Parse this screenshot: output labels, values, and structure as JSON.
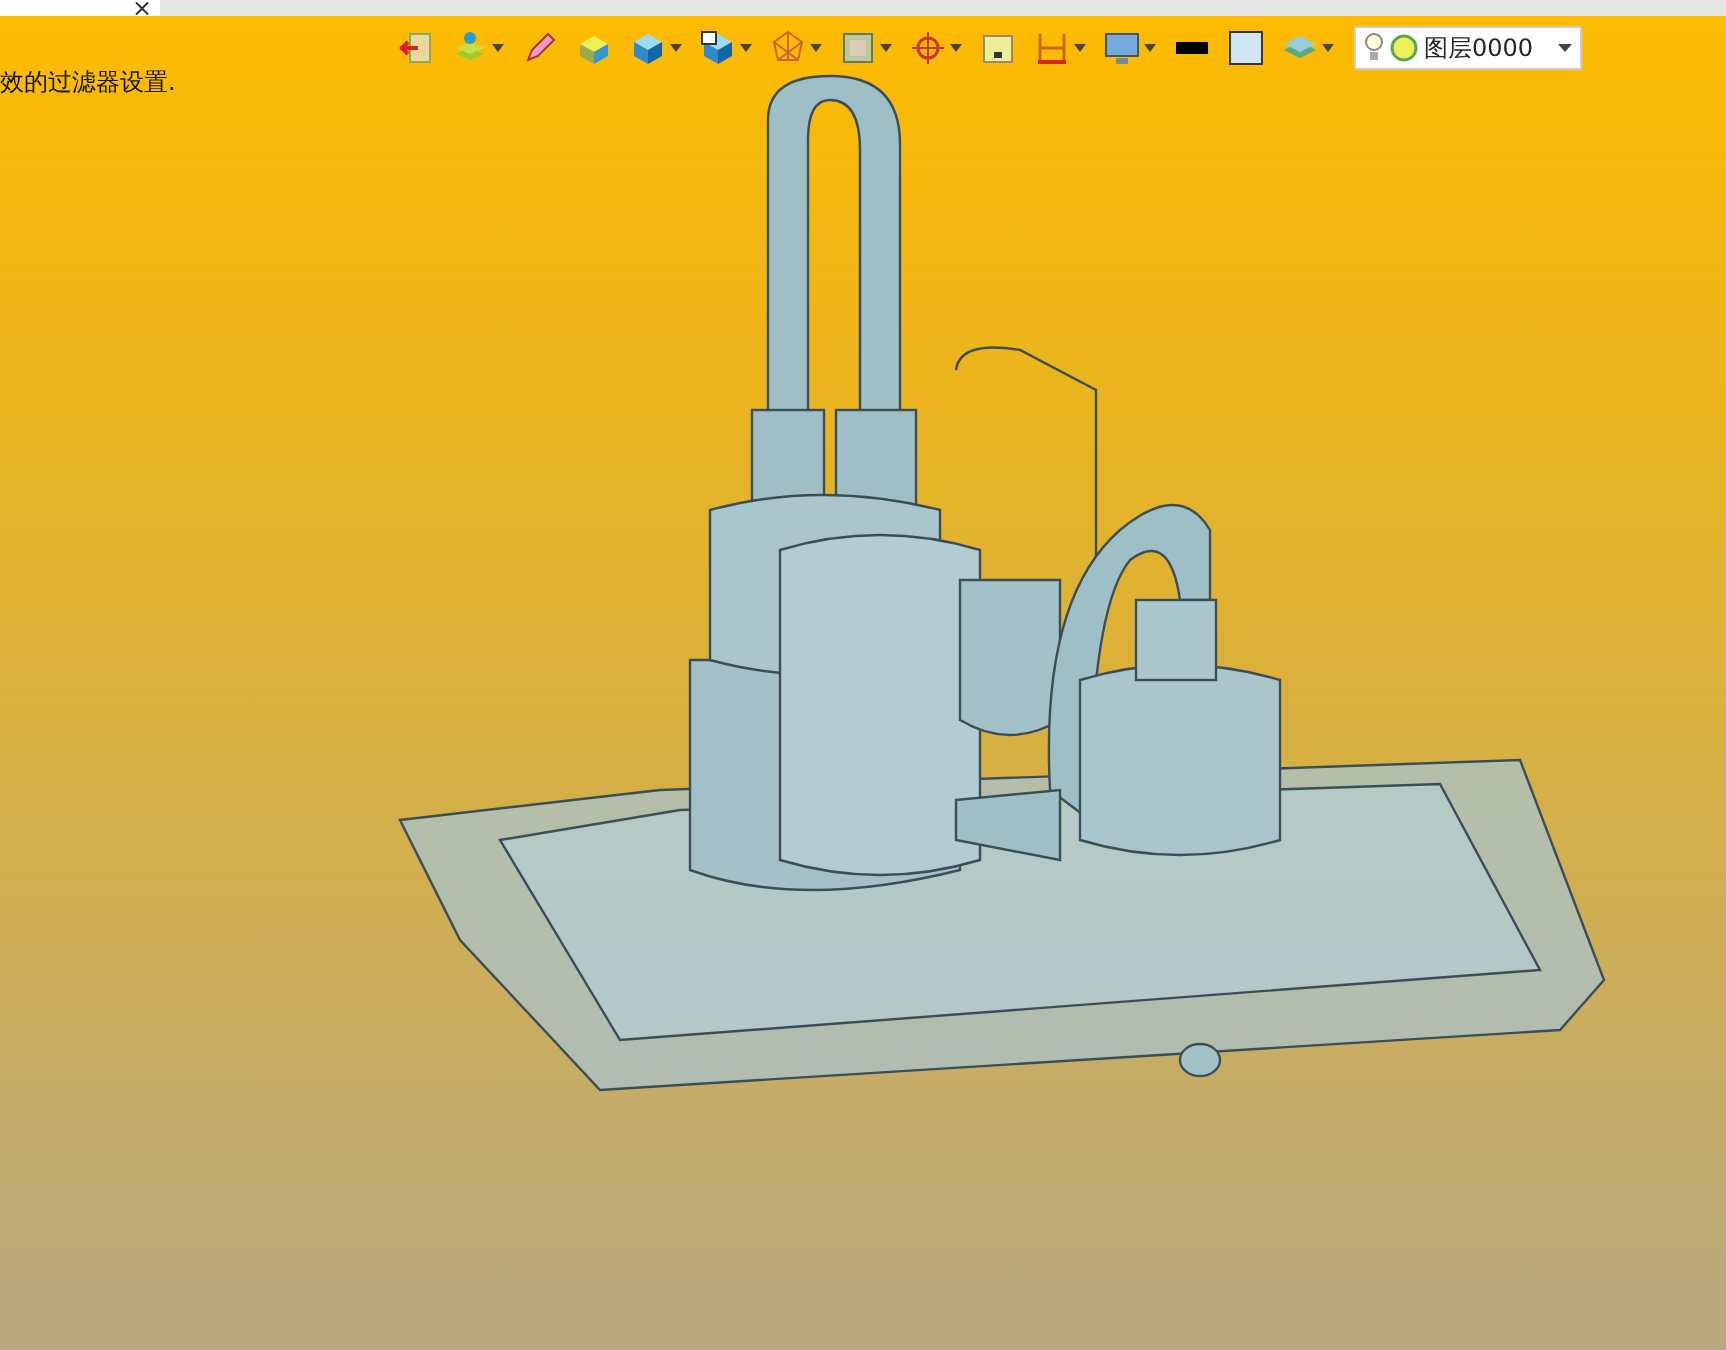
{
  "tab": {
    "close": "×"
  },
  "toolbar": [
    {
      "kind": "exit",
      "dropdown": false
    },
    {
      "kind": "layers",
      "dropdown": true
    },
    {
      "kind": "pen",
      "dropdown": false
    },
    {
      "kind": "cube-yellow",
      "dropdown": false
    },
    {
      "kind": "cube-blue",
      "dropdown": true
    },
    {
      "kind": "cube-view",
      "dropdown": true
    },
    {
      "kind": "wire",
      "dropdown": true
    },
    {
      "kind": "frame",
      "dropdown": true
    },
    {
      "kind": "target",
      "dropdown": true
    },
    {
      "kind": "box",
      "dropdown": false
    },
    {
      "kind": "dimension",
      "dropdown": true
    },
    {
      "kind": "monitor",
      "dropdown": true
    },
    {
      "kind": "color-black",
      "dropdown": false
    },
    {
      "kind": "color-light",
      "dropdown": false
    },
    {
      "kind": "layer-stack",
      "dropdown": true
    }
  ],
  "layer_combo": {
    "value": "图层0000"
  },
  "message": "效的过滤器设置."
}
